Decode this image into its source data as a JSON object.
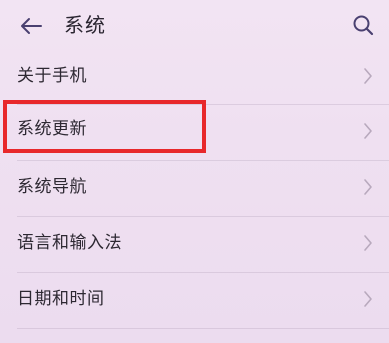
{
  "header": {
    "title": "系统"
  },
  "settings_items": [
    {
      "label": "关于手机"
    },
    {
      "label": "系统更新"
    },
    {
      "label": "系统导航"
    },
    {
      "label": "语言和输入法"
    },
    {
      "label": "日期和时间"
    }
  ],
  "colors": {
    "accent": "#4a4070",
    "highlight": "#e8282b",
    "background": "#efe0f1"
  },
  "icons": {
    "back": "back-arrow-icon",
    "search": "search-icon",
    "chevron": "chevron-right-icon"
  }
}
